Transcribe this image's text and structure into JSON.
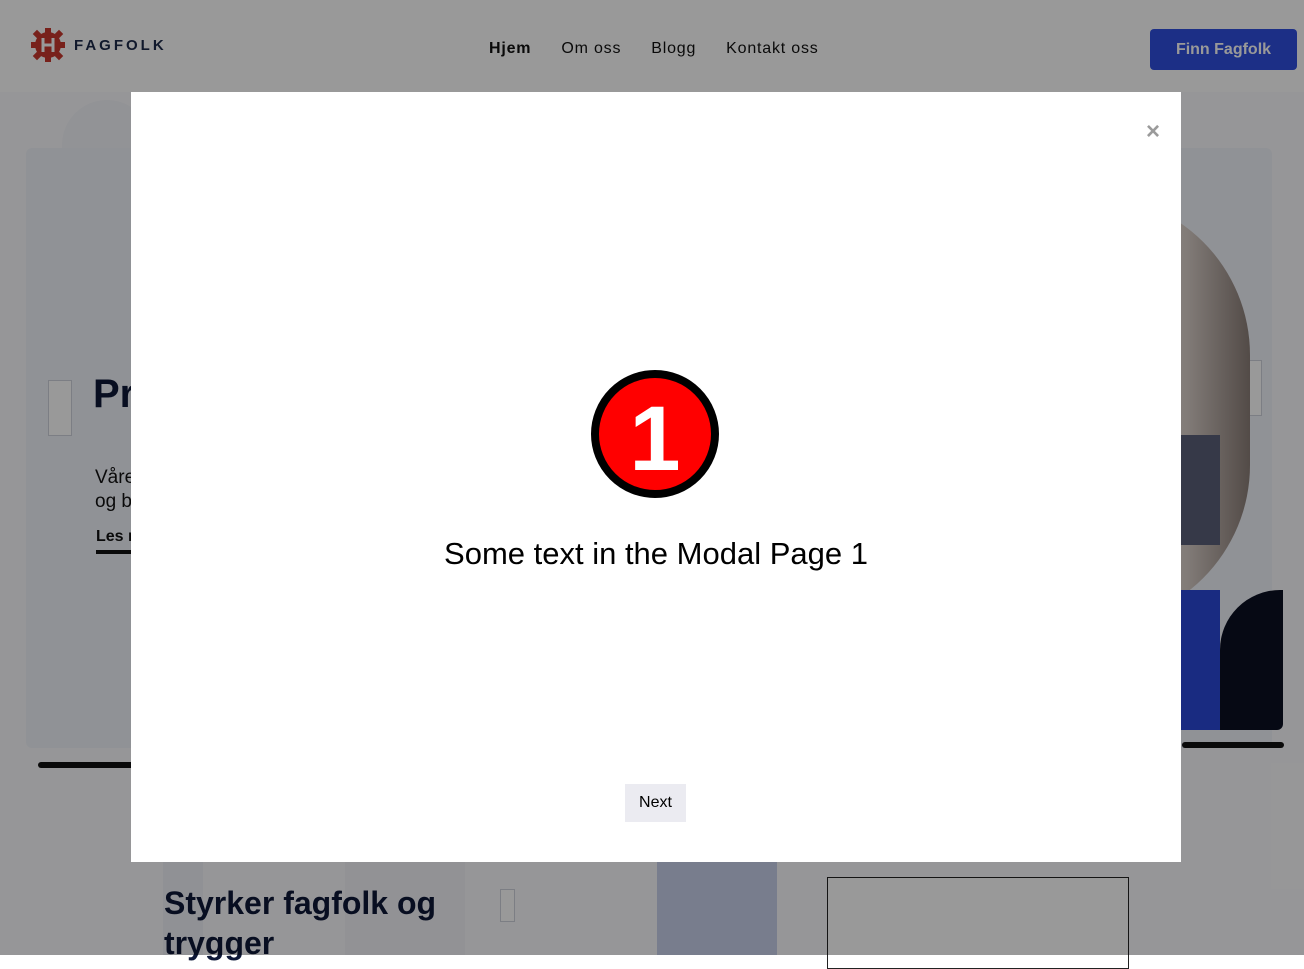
{
  "header": {
    "brand": "FAGFOLK",
    "nav": [
      "Hjem",
      "Om oss",
      "Blogg",
      "Kontakt oss"
    ],
    "active_nav": "Hjem",
    "cta_label": "Finn Fagfolk"
  },
  "hero": {
    "title_partial": "Pr",
    "text_partial_line1": "Våre",
    "text_partial_line2": "og b",
    "link_partial": "Les m"
  },
  "section": {
    "title": "Styrker fagfolk og trygger"
  },
  "modal": {
    "step_number": "1",
    "text": "Some text in the Modal Page 1",
    "next_label": "Next",
    "close_symbol": "×"
  },
  "colors": {
    "accent": "#2f4fe0",
    "badge_fill": "#ff0000",
    "badge_ring": "#000000",
    "overlay": "rgba(0,0,0,0.4)"
  }
}
